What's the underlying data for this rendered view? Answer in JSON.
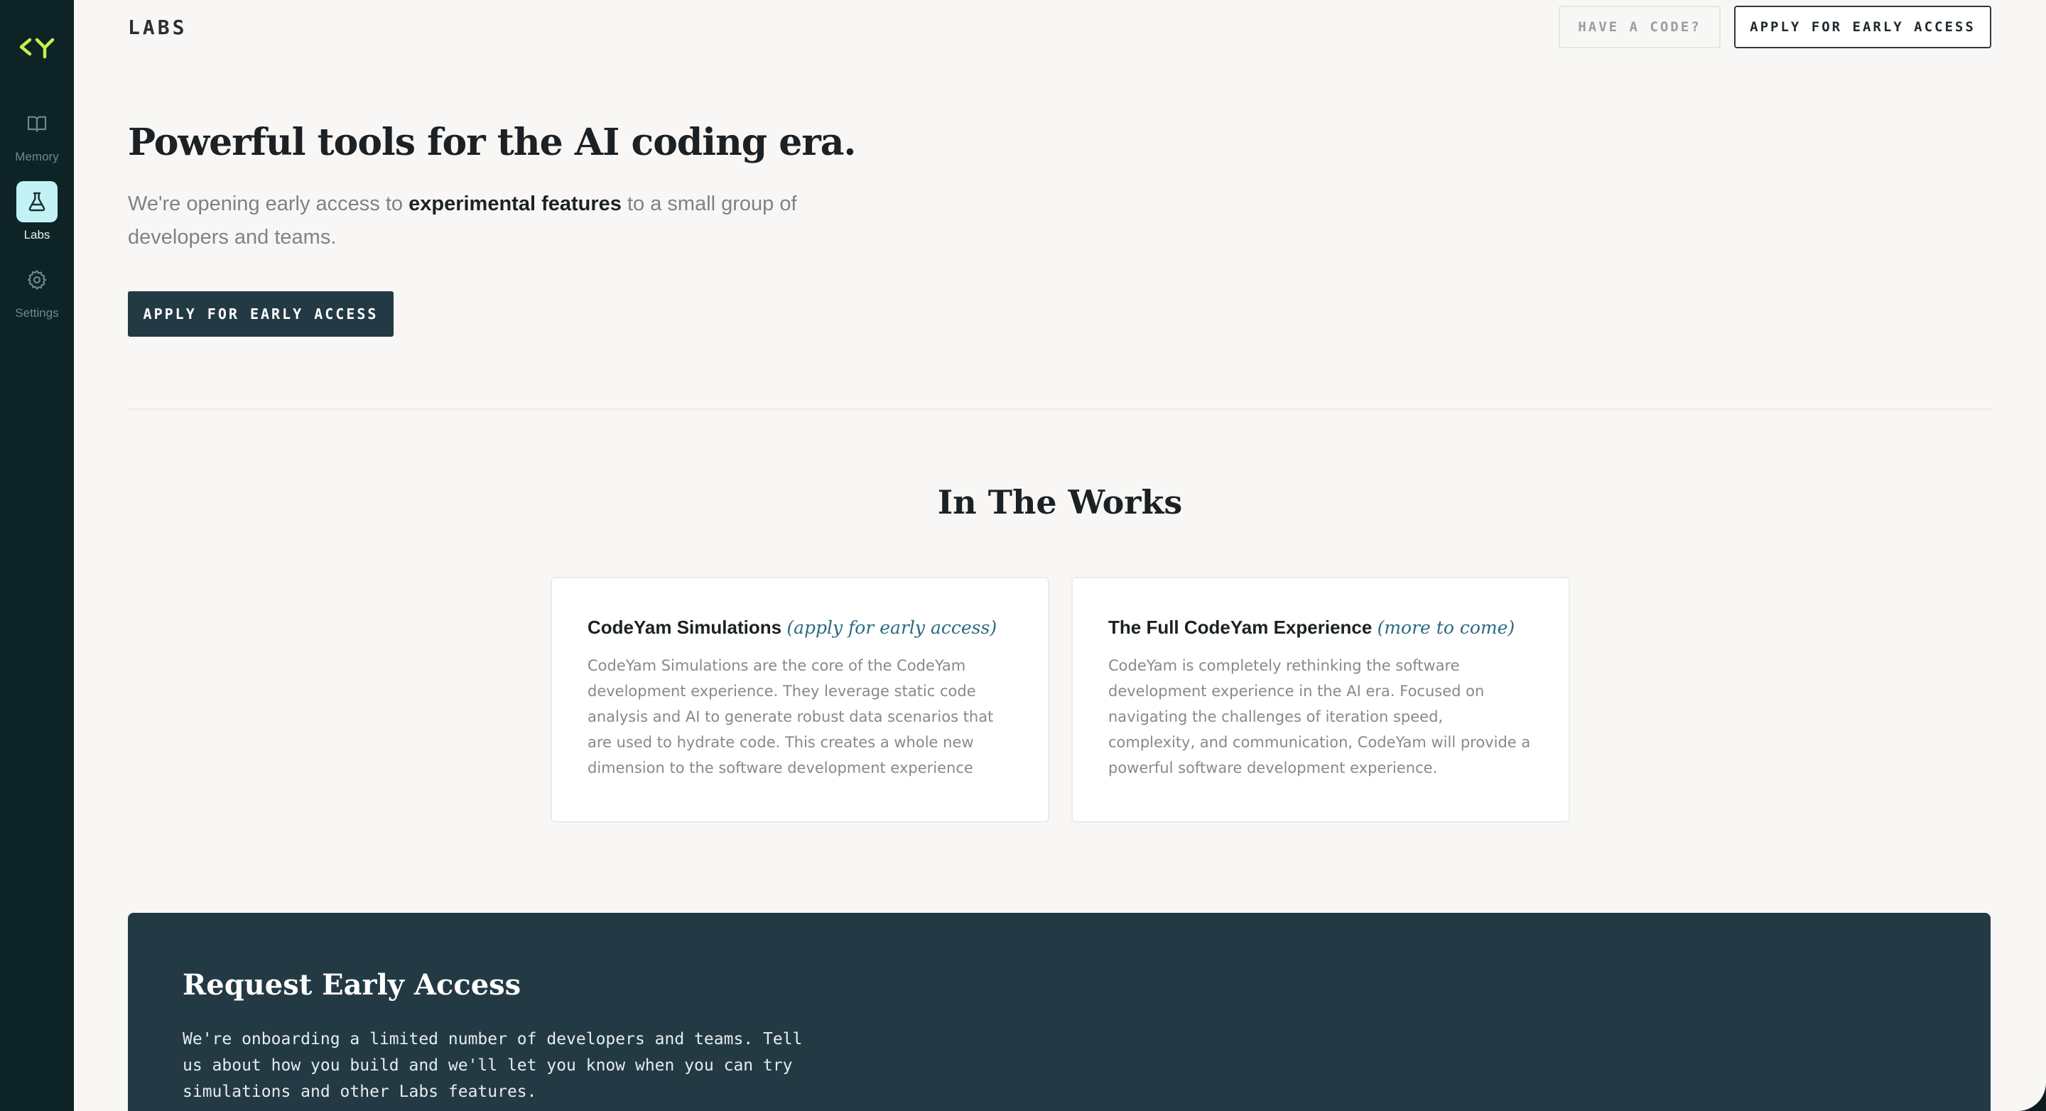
{
  "sidebar": {
    "items": [
      {
        "label": "Memory",
        "icon": "book-icon",
        "active": false
      },
      {
        "label": "Labs",
        "icon": "flask-icon",
        "active": true
      },
      {
        "label": "Settings",
        "icon": "gear-icon",
        "active": false
      }
    ],
    "logo_color": "#c8f04b"
  },
  "header": {
    "title": "LABS",
    "have_code_label": "HAVE A CODE?",
    "apply_label": "APPLY FOR EARLY ACCESS"
  },
  "hero": {
    "title": "Powerful tools for the AI coding era.",
    "sub_pre": "We're opening early access to ",
    "sub_bold": "experimental features",
    "sub_post": " to a small group of developers and teams.",
    "apply_label": "APPLY FOR EARLY ACCESS"
  },
  "works": {
    "title": "In The Works",
    "cards": [
      {
        "title": "CodeYam Simulations",
        "tag": "(apply for early access)",
        "body": "CodeYam Simulations are the core of the CodeYam development experience. They leverage static code analysis and AI to generate robust data scenarios that are used to hydrate code. This creates a whole new dimension to the software development experience"
      },
      {
        "title": "The Full CodeYam Experience",
        "tag": "(more to come)",
        "body": "CodeYam is completely rethinking the software development experience in the AI era. Focused on navigating the challenges of iteration speed, complexity, and communication, CodeYam will provide a powerful software development experience."
      }
    ]
  },
  "request": {
    "title": "Request Early Access",
    "body": "We're onboarding a limited number of developers and teams. Tell us about how you build and we'll let you know when you can try simulations and other Labs features."
  },
  "colors": {
    "sidebar_bg": "#0e2325",
    "accent_dark": "#233a44",
    "active_nav_bg": "#c2f1f6",
    "tag_color": "#2a6a82"
  }
}
